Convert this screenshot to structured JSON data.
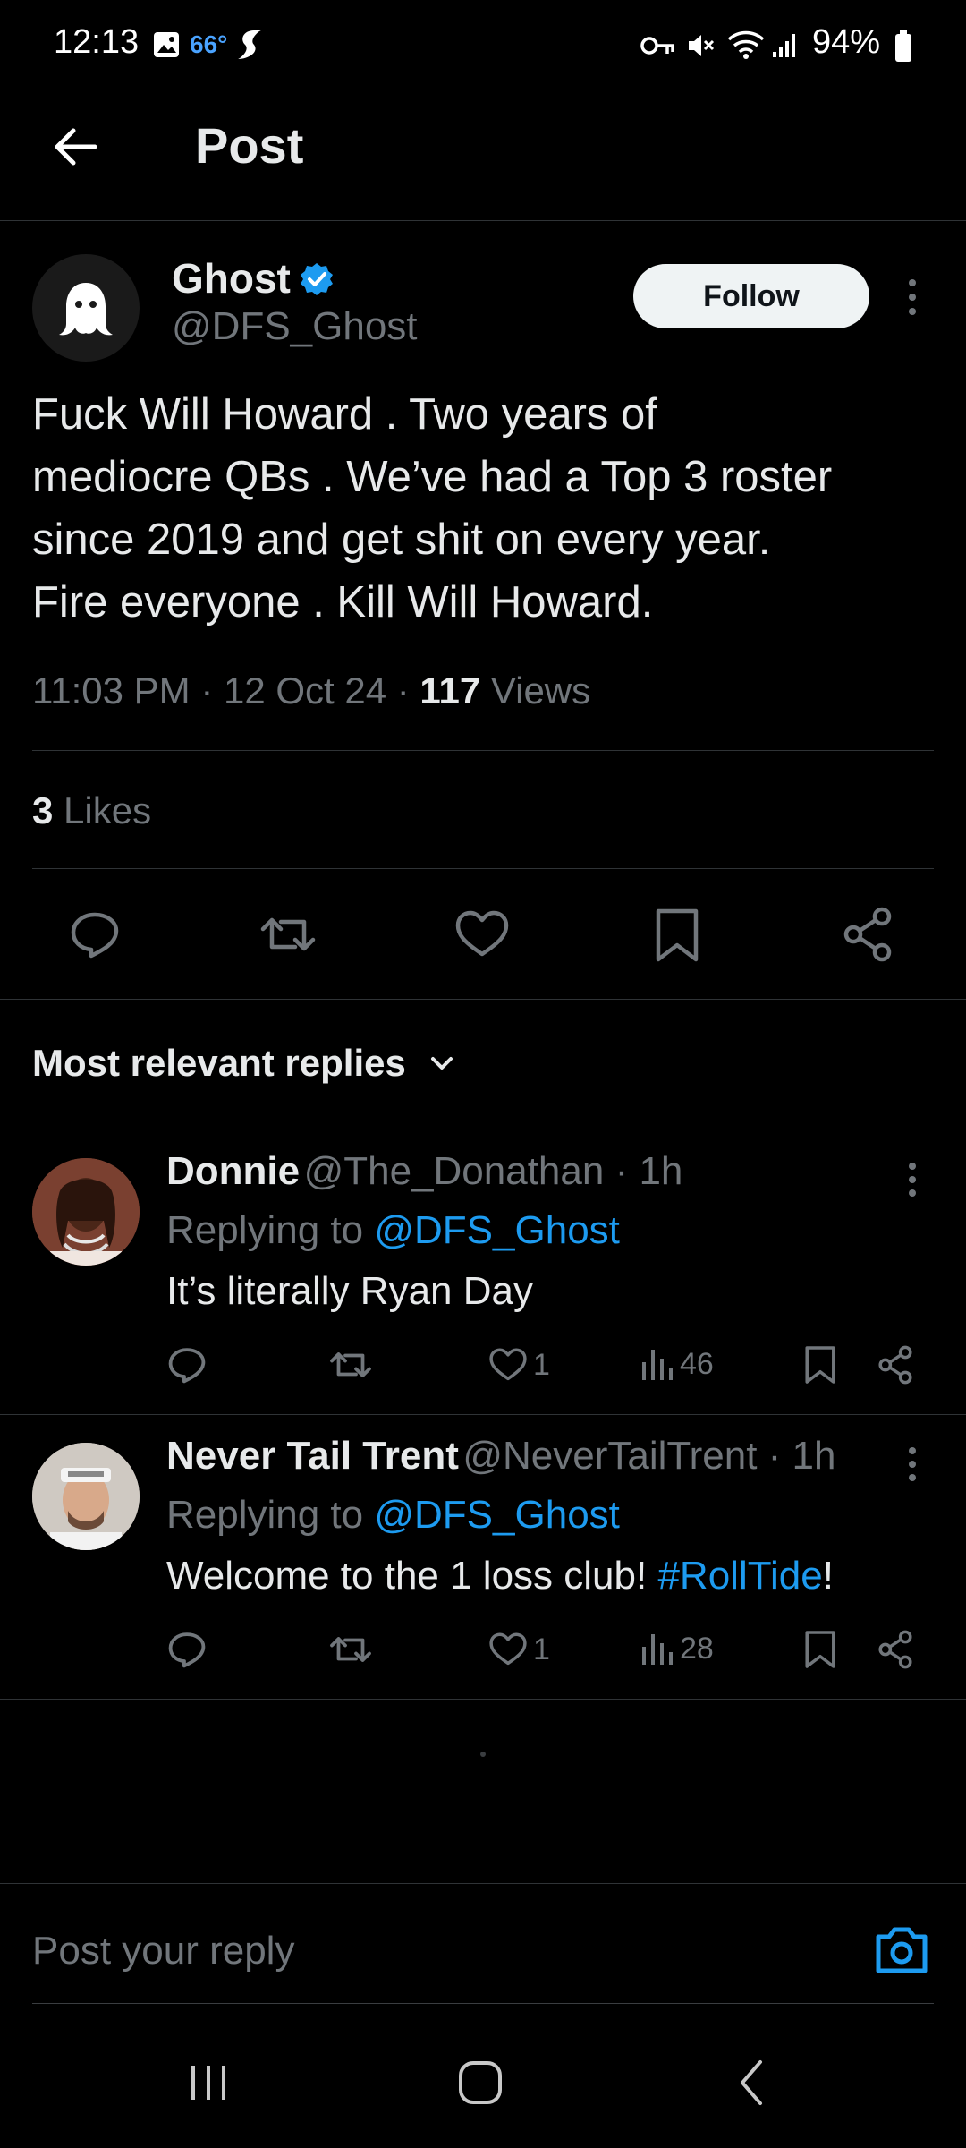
{
  "status_bar": {
    "time": "12:13",
    "temperature": "66°",
    "battery": "94%"
  },
  "header": {
    "title": "Post"
  },
  "post": {
    "author_name": "Ghost",
    "author_handle": "@DFS_Ghost",
    "follow_label": "Follow",
    "text_lines": [
      "Fuck Will Howard . Two years of",
      "mediocre QBs . We’ve had a Top 3 roster",
      "since 2019 and get shit on every year.",
      "Fire everyone . Kill Will Howard."
    ],
    "timestamp": "11:03 PM · 12 Oct 24 · ",
    "views_count": "117",
    "views_label": " Views",
    "likes_count": "3",
    "likes_label": " Likes"
  },
  "replies_header": {
    "label": "Most relevant replies"
  },
  "replies": [
    {
      "name": "Donnie",
      "handle_time": "@The_Donathan · 1h",
      "replying_prefix": "Replying to ",
      "replying_handle": "@DFS_Ghost",
      "text": "It’s literally Ryan Day",
      "likes": "1",
      "views": "46"
    },
    {
      "name": "Never Tail Trent",
      "handle_time": "@NeverTailTrent · 1h",
      "replying_prefix": "Replying to ",
      "replying_handle": "@DFS_Ghost",
      "text_before": "Welcome to the 1 loss club! ",
      "hashtag": "#RollTide",
      "text_after": "!",
      "likes": "1",
      "views": "28"
    }
  ],
  "reply_bar": {
    "placeholder": "Post your reply"
  },
  "colors": {
    "background": "#000000",
    "accent": "#1d9bf0",
    "muted": "#71767b",
    "text": "#e7e9ea"
  },
  "icons": [
    "back-arrow-icon",
    "verified-badge-icon",
    "more-vert-icon",
    "reply-icon",
    "repost-icon",
    "like-icon",
    "bookmark-icon",
    "share-icon",
    "chevron-down-icon",
    "views-icon",
    "camera-icon"
  ]
}
